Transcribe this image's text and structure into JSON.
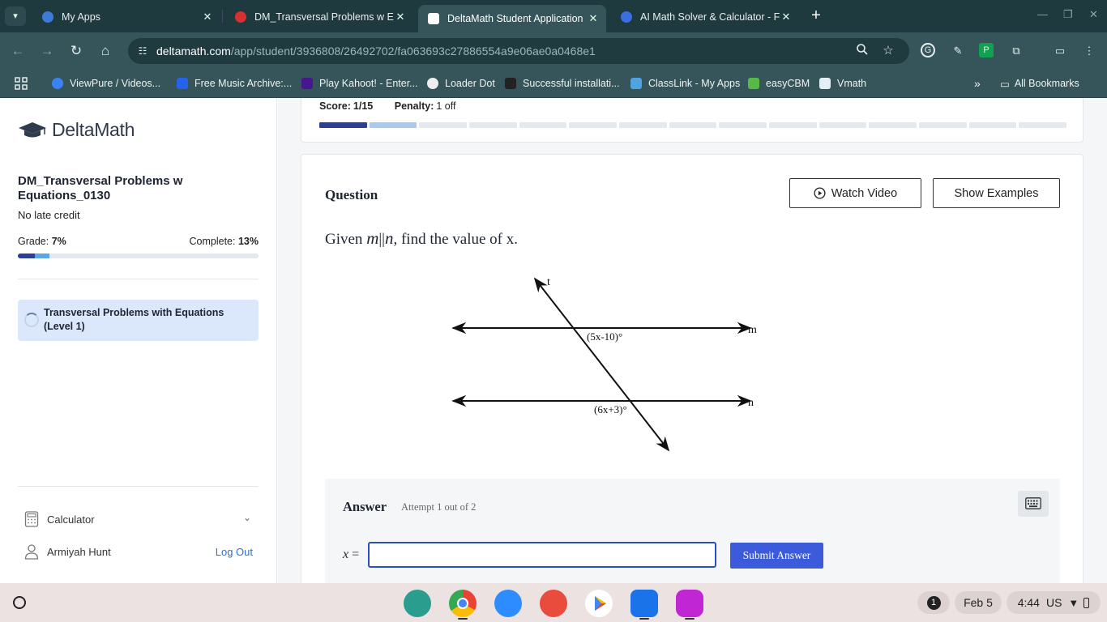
{
  "browser": {
    "tabs": [
      {
        "title": "My Apps",
        "favicon_color": "#3d7bd9",
        "active": false
      },
      {
        "title": "DM_Transversal Problems w Ec",
        "favicon_color": "#d63030",
        "active": false
      },
      {
        "title": "DeltaMath Student Application",
        "favicon_color": "#ffffff",
        "active": true
      },
      {
        "title": "AI Math Solver & Calculator - Fr",
        "favicon_color": "#3b6fe0",
        "active": false
      }
    ],
    "url_host": "deltamath.com",
    "url_path": "/app/student/3936808/26492702/fa063693c27886554a9e06ae0a0468e1",
    "bookmarks": [
      {
        "label": "ViewPure / Videos...",
        "color": "#3b82f6"
      },
      {
        "label": "Free Music Archive:...",
        "color": "#2563eb"
      },
      {
        "label": "Play Kahoot! - Enter...",
        "color": "#46178f"
      },
      {
        "label": "Loader Dot",
        "color": "#eeeeee"
      },
      {
        "label": "Successful installati...",
        "color": "#222222"
      },
      {
        "label": "ClassLink - My Apps",
        "color": "#4fa3e0"
      },
      {
        "label": "easyCBM",
        "color": "#58b947"
      },
      {
        "label": "Vmath",
        "color": "#e6eef5"
      }
    ],
    "all_bookmarks": "All Bookmarks"
  },
  "sidebar": {
    "logo_text": "DeltaMath",
    "assignment_title": "DM_Transversal Problems w Equations_0130",
    "late_credit": "No late credit",
    "grade_label": "Grade:",
    "grade_value": "7%",
    "complete_label": "Complete:",
    "complete_value": "13%",
    "grade_fraction": 0.07,
    "complete_fraction": 0.13,
    "problem_item": "Transversal Problems with Equations (Level 1)",
    "calculator_label": "Calculator",
    "user_name": "Armiyah Hunt",
    "logout_label": "Log Out"
  },
  "score": {
    "score_label": "Score:",
    "score_value": "1/15",
    "penalty_label": "Penalty:",
    "penalty_value": "1 off",
    "total_problems": 15,
    "completed": 1,
    "current_index": 1
  },
  "question": {
    "heading": "Question",
    "watch_video": "Watch Video",
    "show_examples": "Show Examples",
    "prompt_pre": "Given ",
    "prompt_m": "m",
    "prompt_parallel": "||",
    "prompt_n": "n",
    "prompt_post": ", find the value of x.",
    "diagram": {
      "transversal_label": "t",
      "line1_label": "m",
      "line2_label": "n",
      "angle1": "(5x-10)°",
      "angle2": "(6x+3)°"
    }
  },
  "answer": {
    "heading": "Answer",
    "attempt": "Attempt 1 out of 2",
    "variable": "x",
    "equals": "=",
    "input_value": "",
    "submit_label": "Submit Answer"
  },
  "shelf": {
    "notifications": "1",
    "date": "Feb 5",
    "time": "4:44",
    "locale": "US"
  },
  "colors": {
    "accent": "#3b5bdb",
    "progress_done": "#2b3f9a",
    "progress_current": "#a9c9ef",
    "chrome_frame": "#1e3a3f"
  }
}
